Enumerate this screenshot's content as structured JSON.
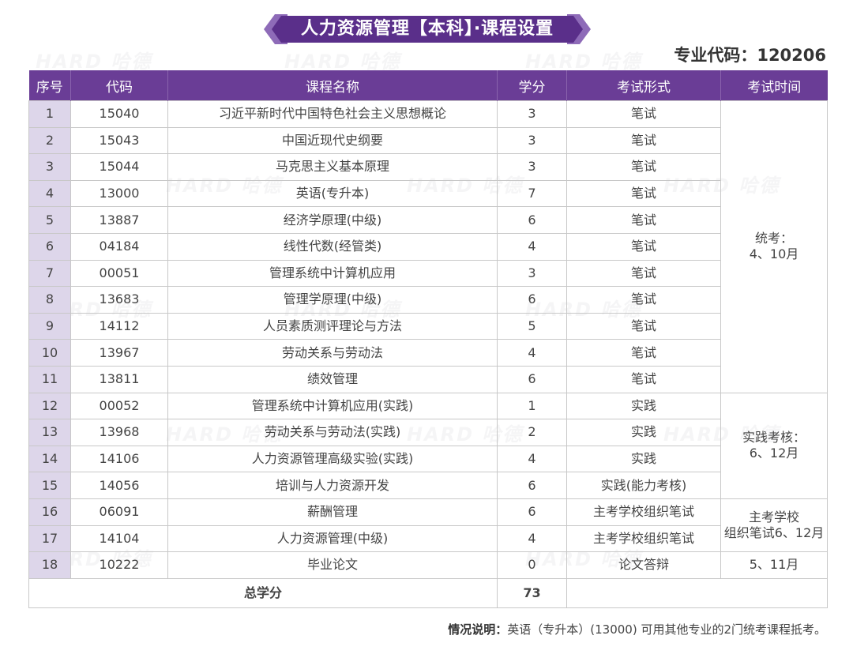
{
  "header": {
    "title": "人力资源管理【本科】·课程设置",
    "major_code_label": "专业代码：",
    "major_code": "120206"
  },
  "watermark": "HARD 哈德",
  "table": {
    "columns": [
      "序号",
      "代码",
      "课程名称",
      "学分",
      "考试形式",
      "考试时间"
    ],
    "rows": [
      {
        "no": "1",
        "code": "15040",
        "name": "习近平新时代中国特色社会主义思想概论",
        "credit": "3",
        "form": "笔试"
      },
      {
        "no": "2",
        "code": "15043",
        "name": "中国近现代史纲要",
        "credit": "3",
        "form": "笔试"
      },
      {
        "no": "3",
        "code": "15044",
        "name": "马克思主义基本原理",
        "credit": "3",
        "form": "笔试"
      },
      {
        "no": "4",
        "code": "13000",
        "name": "英语(专升本)",
        "credit": "7",
        "form": "笔试"
      },
      {
        "no": "5",
        "code": "13887",
        "name": "经济学原理(中级)",
        "credit": "6",
        "form": "笔试"
      },
      {
        "no": "6",
        "code": "04184",
        "name": "线性代数(经管类)",
        "credit": "4",
        "form": "笔试"
      },
      {
        "no": "7",
        "code": "00051",
        "name": "管理系统中计算机应用",
        "credit": "3",
        "form": "笔试"
      },
      {
        "no": "8",
        "code": "13683",
        "name": "管理学原理(中级)",
        "credit": "6",
        "form": "笔试"
      },
      {
        "no": "9",
        "code": "14112",
        "name": "人员素质测评理论与方法",
        "credit": "5",
        "form": "笔试"
      },
      {
        "no": "10",
        "code": "13967",
        "name": "劳动关系与劳动法",
        "credit": "4",
        "form": "笔试"
      },
      {
        "no": "11",
        "code": "13811",
        "name": "绩效管理",
        "credit": "6",
        "form": "笔试"
      },
      {
        "no": "12",
        "code": "00052",
        "name": "管理系统中计算机应用(实践)",
        "credit": "1",
        "form": "实践"
      },
      {
        "no": "13",
        "code": "13968",
        "name": "劳动关系与劳动法(实践)",
        "credit": "2",
        "form": "实践"
      },
      {
        "no": "14",
        "code": "14106",
        "name": "人力资源管理高级实验(实践)",
        "credit": "4",
        "form": "实践"
      },
      {
        "no": "15",
        "code": "14056",
        "name": "培训与人力资源开发",
        "credit": "6",
        "form": "实践(能力考核)"
      },
      {
        "no": "16",
        "code": "06091",
        "name": "薪酬管理",
        "credit": "6",
        "form": "主考学校组织笔试"
      },
      {
        "no": "17",
        "code": "14104",
        "name": "人力资源管理(中级)",
        "credit": "4",
        "form": "主考学校组织笔试"
      },
      {
        "no": "18",
        "code": "10222",
        "name": "毕业论文",
        "credit": "0",
        "form": "论文答辩"
      }
    ],
    "schedule": [
      {
        "line1": "统考：",
        "line2": "4、10月"
      },
      {
        "line1": "实践考核：",
        "line2": "6、12月"
      },
      {
        "line1": "主考学校",
        "line2": "组织笔试6、12月"
      },
      {
        "line1": "5、11月",
        "line2": ""
      }
    ],
    "total_label": "总学分",
    "total_credits": "73"
  },
  "note": {
    "label": "情况说明：",
    "text": "英语（专升本）(13000) 可用其他专业的2门统考课程抵考。"
  },
  "colors": {
    "header_purple": "#6a3d96",
    "index_cell_bg": "#ddd6ea",
    "banner_dark": "#4b2a78"
  }
}
